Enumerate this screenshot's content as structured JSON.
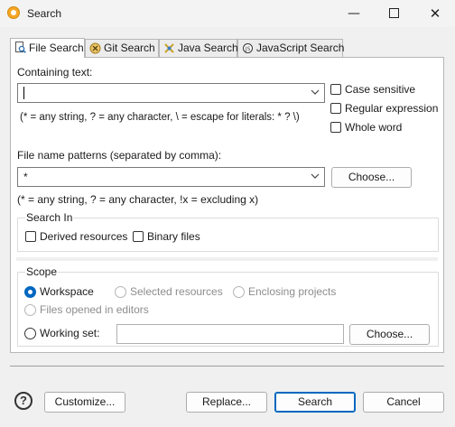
{
  "window": {
    "title": "Search",
    "minimize_glyph": "—",
    "close_glyph": "✕"
  },
  "tabs": [
    {
      "label": "File Search",
      "icon": "file-search-icon",
      "active": true
    },
    {
      "label": "Git Search",
      "icon": "git-icon",
      "active": false
    },
    {
      "label": "Java Search",
      "icon": "java-icon",
      "active": false
    },
    {
      "label": "JavaScript Search",
      "icon": "javascript-icon",
      "active": false
    }
  ],
  "containing": {
    "label": "Containing text:",
    "value": "",
    "hint": "(* = any string, ? = any character, \\ = escape for literals: * ? \\)"
  },
  "options": {
    "case_sensitive": "Case sensitive",
    "regular_expression": "Regular expression",
    "whole_word": "Whole word"
  },
  "patterns": {
    "label": "File name patterns (separated by comma):",
    "value": "*",
    "choose": "Choose...",
    "hint": "(* = any string, ? = any character, !x = excluding x)"
  },
  "search_in": {
    "title": "Search In",
    "derived": "Derived resources",
    "binary": "Binary files"
  },
  "scope": {
    "title": "Scope",
    "workspace": "Workspace",
    "selected_resources": "Selected resources",
    "enclosing_projects": "Enclosing projects",
    "files_opened": "Files opened in editors",
    "working_set": "Working set:",
    "working_set_value": "",
    "choose": "Choose..."
  },
  "footer": {
    "help": "?",
    "customize": "Customize...",
    "replace": "Replace...",
    "search": "Search",
    "cancel": "Cancel"
  },
  "colors": {
    "accent": "#0067c0",
    "app_icon": "#f5a623"
  }
}
